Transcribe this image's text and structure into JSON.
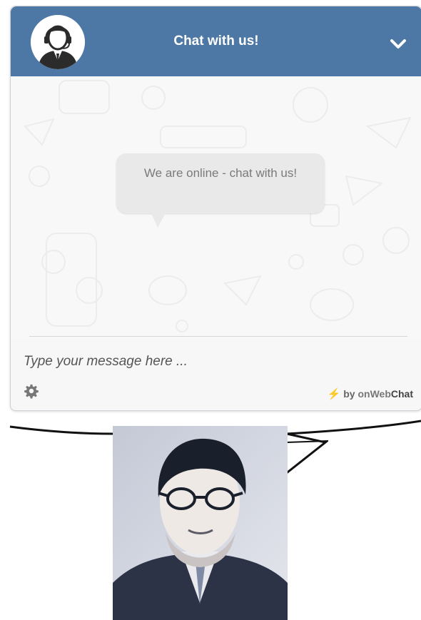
{
  "header": {
    "title": "Chat with us!",
    "avatar_icon": "support-agent-icon",
    "collapse_icon": "chevron-down-icon",
    "color": "#4d78a5"
  },
  "chat": {
    "welcome_message": "We are online - chat with us!"
  },
  "composer": {
    "placeholder": "Type your message here ...",
    "value": "",
    "settings_icon": "gear-icon"
  },
  "branding": {
    "prefix": "by ",
    "name_light": "onWeb",
    "name_bold": "Chat",
    "icon": "lightning-icon",
    "icon_color": "#f0b63b"
  },
  "portrait": {
    "description_icon": "person-portrait-image"
  }
}
